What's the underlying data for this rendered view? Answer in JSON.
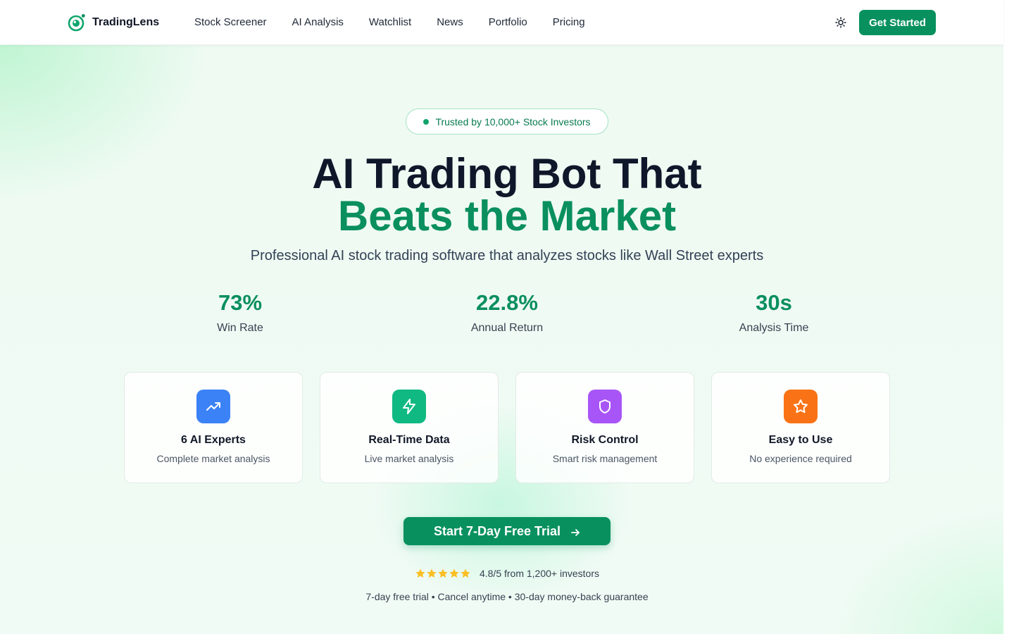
{
  "brand": {
    "name": "TradingLens",
    "logo_icon": "eye-logo-icon",
    "accent": "#08915e"
  },
  "nav": {
    "links": [
      "Stock Screener",
      "AI Analysis",
      "Watchlist",
      "News",
      "Portfolio",
      "Pricing"
    ],
    "theme_icon": "sun-icon",
    "cta_label": "Get Started"
  },
  "hero": {
    "badge": "Trusted by 10,000+ Stock Investors",
    "title_line1": "AI Trading Bot That",
    "title_line2": "Beats the Market",
    "subtitle": "Professional AI stock trading software that analyzes stocks like Wall Street experts"
  },
  "stats": [
    {
      "value": "73%",
      "label": "Win Rate"
    },
    {
      "value": "22.8%",
      "label": "Annual Return"
    },
    {
      "value": "30s",
      "label": "Analysis Time"
    }
  ],
  "features": [
    {
      "title": "6 AI Experts",
      "desc": "Complete market analysis",
      "icon": "trending-up-icon",
      "color": "#3b82f6"
    },
    {
      "title": "Real-Time Data",
      "desc": "Live market analysis",
      "icon": "lightning-icon",
      "color": "#10b981"
    },
    {
      "title": "Risk Control",
      "desc": "Smart risk management",
      "icon": "shield-icon",
      "color": "#a855f7"
    },
    {
      "title": "Easy to Use",
      "desc": "No experience required",
      "icon": "star-icon",
      "color": "#f97316"
    }
  ],
  "cta": {
    "label": "Start 7-Day Free Trial",
    "icon": "arrow-right-icon"
  },
  "rating": {
    "stars": 5,
    "text": "4.8/5 from 1,200+ investors",
    "star_color": "#fbbf24"
  },
  "guarantee": "7-day free trial • Cancel anytime • 30-day money-back guarantee"
}
